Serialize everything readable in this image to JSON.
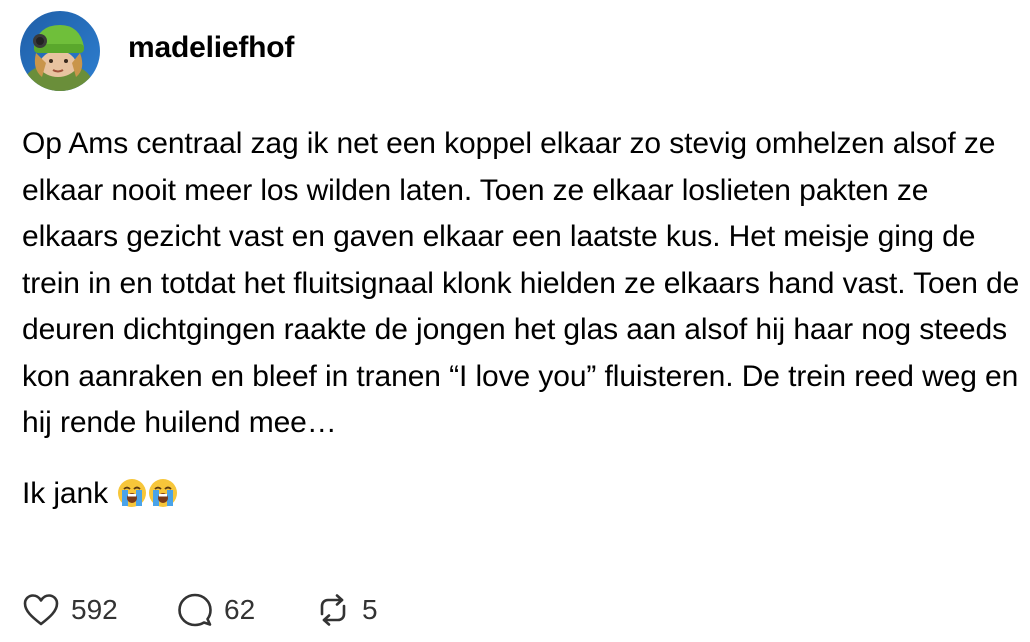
{
  "post": {
    "username": "madeliefhof",
    "text": "Op Ams centraal zag ik net een koppel elkaar zo stevig omhelzen alsof ze elkaar nooit meer los wilden laten. Toen ze elkaar loslieten pakten ze elkaars gezicht vast en gaven elkaar een laatste kus. Het meisje ging de trein in en totdat het fluitsignaal klonk hielden ze elkaars hand vast. Toen de deuren dichtgingen raakte de jongen het glas aan alsof hij haar nog steeds kon aanraken en bleef in tranen “I love you” fluisteren. De trein reed weg en hij rende huilend mee…",
    "closing_text": "Ik jank",
    "closing_emojis": [
      "loudly-crying-face-emoji",
      "loudly-crying-face-emoji"
    ]
  },
  "actions": {
    "likes": "592",
    "replies": "62",
    "reposts": "5",
    "like_icon": "heart-icon",
    "reply_icon": "speech-bubble-icon",
    "repost_icon": "repost-arrows-icon"
  }
}
